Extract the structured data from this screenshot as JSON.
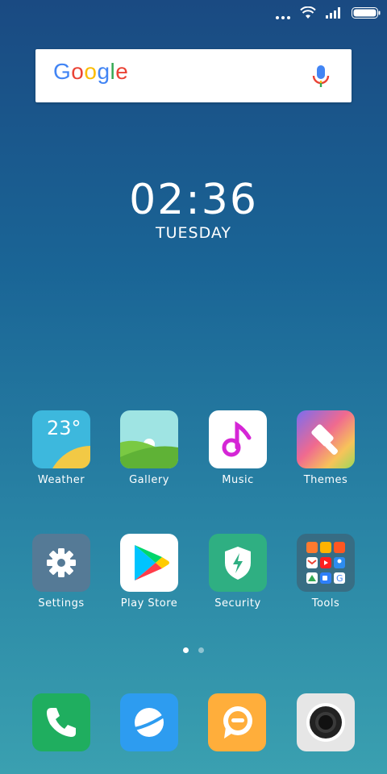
{
  "status_bar": {
    "icons": [
      "more-dots-icon",
      "wifi-icon",
      "signal-icon",
      "battery-icon"
    ]
  },
  "search": {
    "logo_text": [
      "G",
      "o",
      "o",
      "g",
      "l",
      "e"
    ],
    "logo_colors": [
      "#4285F4",
      "#EA4335",
      "#FBBC05",
      "#4285F4",
      "#34A853",
      "#EA4335"
    ],
    "mic_icon": "mic-icon"
  },
  "clock": {
    "time": "02:36",
    "day": "TUESDAY"
  },
  "apps": {
    "row1": [
      {
        "label": "Weather",
        "icon": "weather-icon",
        "temp": "23°"
      },
      {
        "label": "Gallery",
        "icon": "gallery-icon"
      },
      {
        "label": "Music",
        "icon": "music-icon"
      },
      {
        "label": "Themes",
        "icon": "themes-icon"
      }
    ],
    "row2": [
      {
        "label": "Settings",
        "icon": "gear-icon"
      },
      {
        "label": "Play Store",
        "icon": "play-store-icon"
      },
      {
        "label": "Security",
        "icon": "security-shield-icon"
      },
      {
        "label": "Tools",
        "icon": "tools-folder-icon"
      }
    ]
  },
  "pages": {
    "count": 2,
    "active": 1
  },
  "dock": [
    {
      "name": "phone",
      "icon": "phone-icon",
      "color": "#1fae5f"
    },
    {
      "name": "browser",
      "icon": "browser-icon",
      "color": "#2d9cf0"
    },
    {
      "name": "messaging",
      "icon": "message-icon",
      "color": "#ffae3b"
    },
    {
      "name": "camera",
      "icon": "camera-icon",
      "color": "#e6e6e6"
    }
  ]
}
